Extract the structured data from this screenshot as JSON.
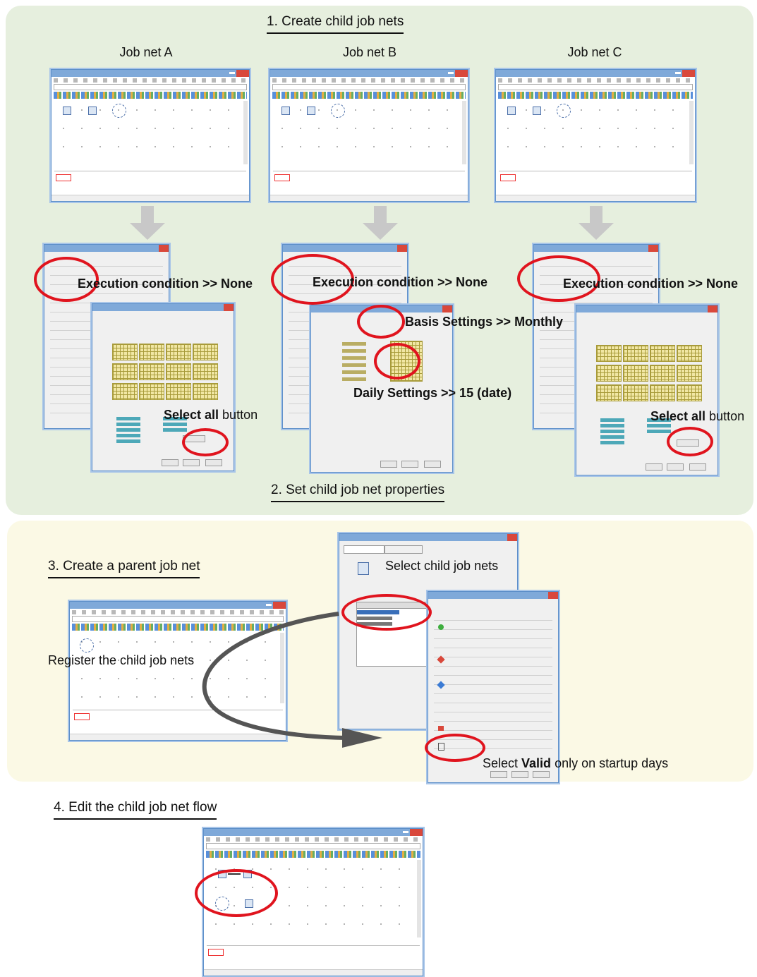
{
  "steps": {
    "step1": "1. Create child job nets",
    "step2": "2. Set child job net properties",
    "step3": "3. Create a parent job net",
    "step4": "4. Edit the child job net flow"
  },
  "columns": {
    "a": "Job net A",
    "b": "Job net B",
    "c": "Job net C"
  },
  "callouts": {
    "exec_condition": "Execution condition >> None",
    "basis_settings": "Basis Settings >> Monthly",
    "daily_settings": "Daily Settings >> 15 (date)",
    "select_all_bold": "Select all",
    "select_all_rest": " button",
    "select_child": "Select child job nets",
    "register_child": "Register the child job nets",
    "select_valid_prefix": "Select ",
    "select_valid_bold": "Valid",
    "select_valid_rest": " only on startup days"
  },
  "colors": {
    "green_panel": "#e6efde",
    "yellow_panel": "#fbf9e5",
    "highlight_red": "#e0141e",
    "arrow_gray": "#c8c8c8",
    "flow_arrow": "#555555"
  }
}
